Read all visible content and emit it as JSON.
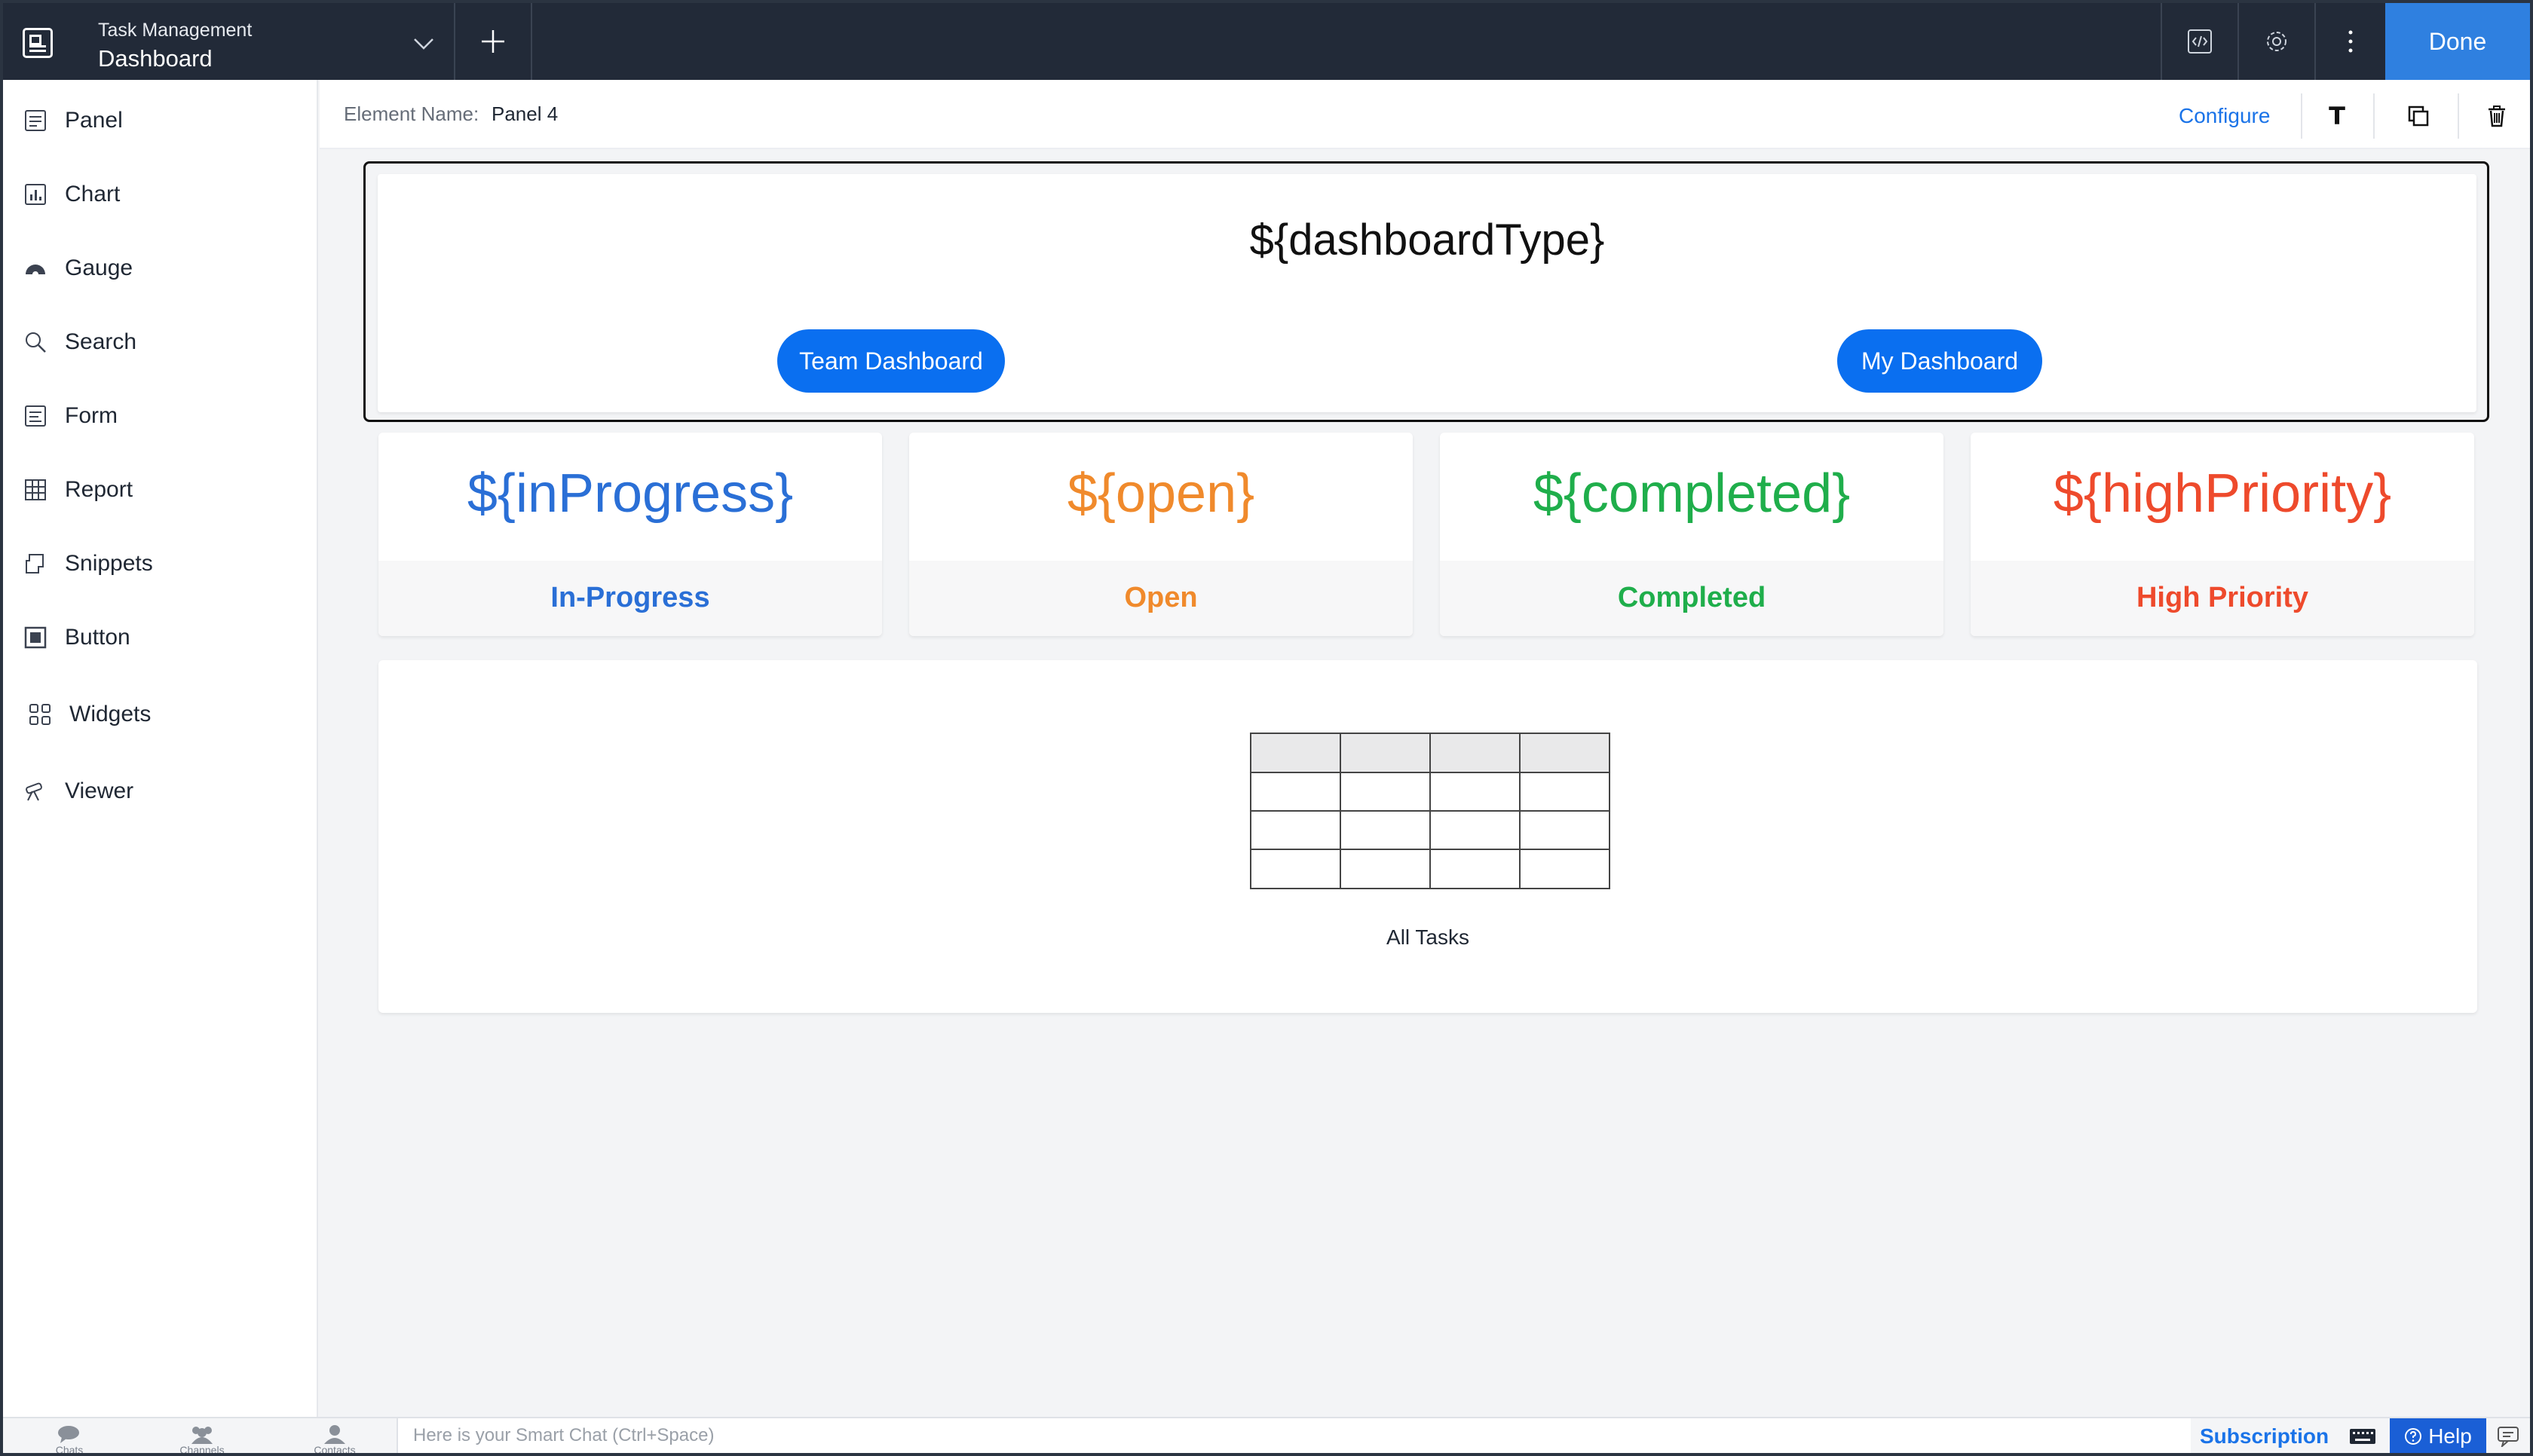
{
  "header": {
    "app_subtitle": "Task Management",
    "app_title": "Dashboard",
    "done_label": "Done"
  },
  "sidebar": {
    "items": [
      {
        "label": "Panel",
        "icon": "panel-icon"
      },
      {
        "label": "Chart",
        "icon": "chart-icon"
      },
      {
        "label": "Gauge",
        "icon": "gauge-icon"
      },
      {
        "label": "Search",
        "icon": "search-icon"
      },
      {
        "label": "Form",
        "icon": "form-icon"
      },
      {
        "label": "Report",
        "icon": "report-icon"
      },
      {
        "label": "Snippets",
        "icon": "snippets-icon"
      },
      {
        "label": "Button",
        "icon": "button-icon"
      },
      {
        "label": "Widgets",
        "icon": "widgets-icon"
      },
      {
        "label": "Viewer",
        "icon": "viewer-icon"
      }
    ]
  },
  "element_bar": {
    "name_key": "Element Name:",
    "name_value": "Panel 4",
    "configure_label": "Configure",
    "text_tool": "T"
  },
  "canvas": {
    "dashboard_type": "${dashboardType}",
    "team_button": "Team Dashboard",
    "my_button": "My Dashboard",
    "stats": [
      {
        "value": "${inProgress}",
        "label": "In-Progress",
        "color": "#2a6fd6"
      },
      {
        "value": "${open}",
        "label": "Open",
        "color": "#f08a2c"
      },
      {
        "value": "${completed}",
        "label": "Completed",
        "color": "#1fae4b"
      },
      {
        "value": "${highPriority}",
        "label": "High Priority",
        "color": "#ee4a2c"
      }
    ],
    "table_caption": "All Tasks"
  },
  "bottombar": {
    "nav": [
      "Chats",
      "Channels",
      "Contacts"
    ],
    "smart_chat_placeholder": "Here is your Smart Chat (Ctrl+Space)",
    "subscription_label": "Subscription",
    "help_label": "Help"
  },
  "colors": {
    "topbar": "#222a38",
    "accent": "#2f80e0",
    "pill": "#0a6ff0"
  }
}
